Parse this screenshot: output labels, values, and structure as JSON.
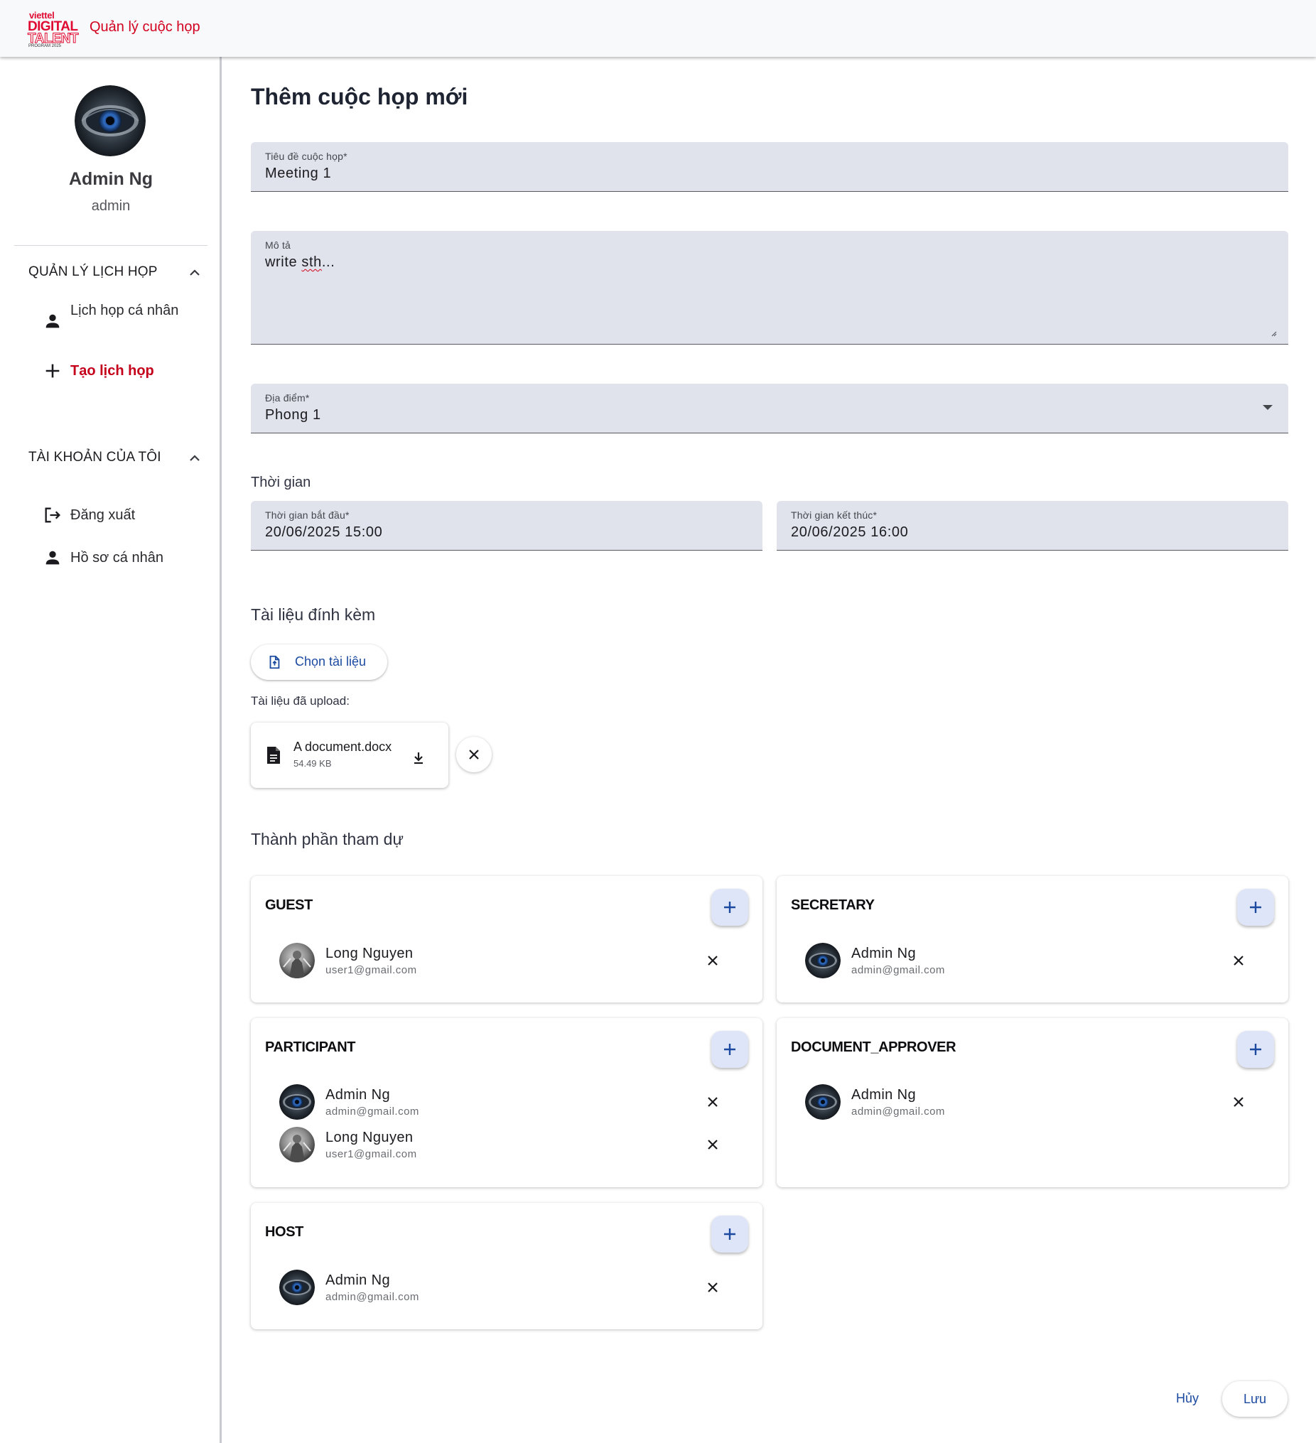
{
  "brand": {
    "logo_viettel": "viettel",
    "logo_digital": "DIGITAL",
    "logo_talent": "TALENT",
    "logo_program": "PROGRAM 2025",
    "app_title": "Quản lý cuộc họp",
    "accent_color": "#d2001f"
  },
  "sidebar": {
    "user_name": "Admin Ng",
    "user_role": "admin",
    "sections": [
      {
        "title": "QUẢN LÝ LỊCH HỌP",
        "items": [
          {
            "label": "Lịch họp cá nhân",
            "icon": "person-icon",
            "active": false
          },
          {
            "label": "Tạo lịch họp",
            "icon": "plus-icon",
            "active": true
          }
        ]
      },
      {
        "title": "TÀI KHOẢN CỦA TÔI",
        "items": [
          {
            "label": "Đăng xuất",
            "icon": "logout-icon",
            "active": false
          },
          {
            "label": "Hồ sơ cá nhân",
            "icon": "person-icon",
            "active": false
          }
        ]
      }
    ]
  },
  "form": {
    "page_title": "Thêm cuộc họp mới",
    "title_field": {
      "label": "Tiêu đề cuộc họp*",
      "value": "Meeting 1"
    },
    "description_field": {
      "label": "Mô tả",
      "value_prefix": "write ",
      "value_misspelled": "sth",
      "value_suffix": "..."
    },
    "location_field": {
      "label": "Địa điểm*",
      "value": "Phong 1"
    },
    "time_section": "Thời gian",
    "start_field": {
      "label": "Thời gian bắt đầu*",
      "value": "20/06/2025 15:00"
    },
    "end_field": {
      "label": "Thời gian kết thúc*",
      "value": "20/06/2025 16:00"
    },
    "attachments_title": "Tài liệu đính kèm",
    "choose_button": "Chọn tài liệu",
    "uploaded_label": "Tài liệu đã upload:",
    "file": {
      "name": "A document.docx",
      "size": "54.49 KB"
    },
    "attendees_title": "Thành phần tham dự",
    "roles": {
      "guest": {
        "name": "GUEST",
        "members": [
          {
            "name": "Long Nguyen",
            "email": "user1@gmail.com",
            "avatar": "gray"
          }
        ]
      },
      "secretary": {
        "name": "SECRETARY",
        "members": [
          {
            "name": "Admin Ng",
            "email": "admin@gmail.com",
            "avatar": "eye"
          }
        ]
      },
      "participant": {
        "name": "PARTICIPANT",
        "members": [
          {
            "name": "Admin Ng",
            "email": "admin@gmail.com",
            "avatar": "eye"
          },
          {
            "name": "Long Nguyen",
            "email": "user1@gmail.com",
            "avatar": "gray"
          }
        ]
      },
      "document_approver": {
        "name": "DOCUMENT_APPROVER",
        "members": [
          {
            "name": "Admin Ng",
            "email": "admin@gmail.com",
            "avatar": "eye"
          }
        ]
      },
      "host": {
        "name": "HOST",
        "members": [
          {
            "name": "Admin Ng",
            "email": "admin@gmail.com",
            "avatar": "eye"
          }
        ]
      }
    },
    "cancel_button": "Hủy",
    "save_button": "Lưu",
    "primary_color": "#1b4aa0"
  }
}
